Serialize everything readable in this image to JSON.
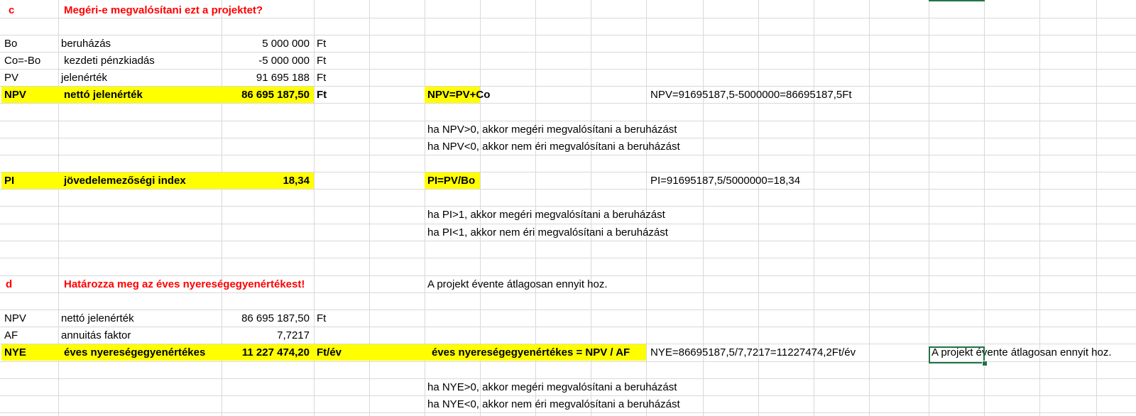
{
  "section_c": {
    "letter": "c",
    "title": "Megéri-e megvalósítani ezt a projektet?",
    "rows": [
      {
        "code": "Bo",
        "label": "beruházás",
        "value": "5 000 000",
        "unit": "Ft"
      },
      {
        "code": "Co=-Bo",
        "label": " kezdeti pénzkiadás",
        "value": "-5 000 000",
        "unit": "Ft"
      },
      {
        "code": "PV",
        "label": "jelenérték",
        "value": "91 695 188",
        "unit": "Ft"
      }
    ],
    "npv": {
      "code": "NPV",
      "label": "nettó jelenérték",
      "value": "86 695 187,50",
      "unit": "Ft",
      "formula": "NPV=PV+Co",
      "calc": "NPV=91695187,5-5000000=86695187,5Ft"
    },
    "npv_rules": [
      "ha NPV>0, akkor megéri megvalósítani a beruházást",
      "ha NPV<0, akkor nem éri megvalósítani a beruházást"
    ],
    "pi": {
      "code": "PI",
      "label": "jövedelemezőségi index",
      "value": "18,34",
      "formula": "PI=PV/Bo",
      "calc": "PI=91695187,5/5000000=18,34"
    },
    "pi_rules": [
      "ha PI>1, akkor megéri megvalósítani a beruházást",
      "ha PI<1, akkor nem éri megvalósítani a beruházást"
    ]
  },
  "section_d": {
    "letter": "d",
    "title": "Határozza meg az éves nyereségegyenértékest!",
    "note": "A projekt évente átlagosan ennyit hoz.",
    "rows": [
      {
        "code": "NPV",
        "label": "nettó jelenérték",
        "value": "86 695 187,50",
        "unit": "Ft"
      },
      {
        "code": "AF",
        "label": "annuitás faktor",
        "value": "7,7217",
        "unit": ""
      }
    ],
    "nye": {
      "code": "NYE",
      "label": "éves nyereségegyenértékes",
      "value": "11 227 474,20",
      "unit": "Ft/év",
      "formula": "éves nyereségegyenértékes = NPV / AF",
      "calc": "NYE=86695187,5/7,7217=11227474,2Ft/év",
      "selected_cell_text": "A projekt évente átlagosan ennyit hoz."
    },
    "nye_rules": [
      "ha NYE>0, akkor megéri megvalósítani a beruházást",
      "ha NYE<0, akkor nem éri megvalósítani a beruházást"
    ]
  },
  "colors": {
    "highlight": "#ffff00",
    "title_red": "#ff0000",
    "selection": "#217346"
  }
}
